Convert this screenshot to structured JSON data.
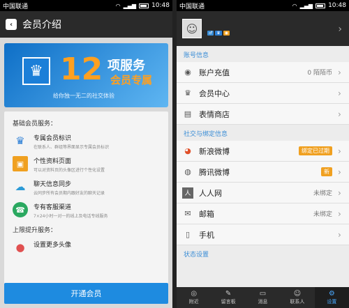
{
  "left": {
    "status": {
      "carrier": "中国联通",
      "time": "10:48"
    },
    "header": {
      "title": "会员介绍"
    },
    "banner": {
      "number": "12",
      "services": "项服务",
      "vip": "会员专属",
      "slogan": "给你独一无二的社交体验"
    },
    "basic_title": "基础会员服务：",
    "services": [
      {
        "icon": "crown-icon",
        "title": "专属会员标识",
        "desc": "在联系人、群组等界面显示专属会员标识"
      },
      {
        "icon": "profile-card-icon",
        "title": "个性资料页面",
        "desc": "可以对资料页的头像区进行个性化设置"
      },
      {
        "icon": "cloud-sync-icon",
        "title": "聊天信息同步",
        "desc": "云同步所有会员期内跟好友的聊天记录"
      },
      {
        "icon": "phone-icon",
        "title": "专有客服渠道",
        "desc": "7×24小时一对一的线上及电话专线服务"
      }
    ],
    "upgrade_title": "上限提升服务：",
    "upgrade_item": "设置更多头像",
    "open_button": "开通会员"
  },
  "right": {
    "status": {
      "carrier": "中国联通",
      "time": "10:48"
    },
    "account_section": "账号信息",
    "account_rows": [
      {
        "icon": "wallet-icon",
        "label": "账户充值",
        "value": "0 陌陌币"
      },
      {
        "icon": "crown-icon",
        "label": "会员中心",
        "value": ""
      },
      {
        "icon": "store-icon",
        "label": "表情商店",
        "value": ""
      }
    ],
    "social_section": "社交与绑定信息",
    "social_rows": [
      {
        "icon": "weibo-icon",
        "label": "新浪微博",
        "tag": "绑定已过期",
        "tag_color": "#f0a020",
        "value": ""
      },
      {
        "icon": "tencent-weibo-icon",
        "label": "腾讯微博",
        "tag": "新",
        "tag_color": "#f0a020",
        "value": ""
      },
      {
        "icon": "renren-icon",
        "label": "人人网",
        "tag": "",
        "value": "未绑定"
      },
      {
        "icon": "mail-icon",
        "label": "邮箱",
        "tag": "",
        "value": "未绑定"
      },
      {
        "icon": "mobile-icon",
        "label": "手机",
        "tag": "",
        "value": ""
      }
    ],
    "status_section": "状态设置",
    "tabs": [
      {
        "icon": "location-icon",
        "label": "附近"
      },
      {
        "icon": "message-board-icon",
        "label": "留言板"
      },
      {
        "icon": "chat-icon",
        "label": "消息"
      },
      {
        "icon": "contacts-icon",
        "label": "联系人"
      },
      {
        "icon": "settings-icon",
        "label": "设置"
      }
    ]
  }
}
